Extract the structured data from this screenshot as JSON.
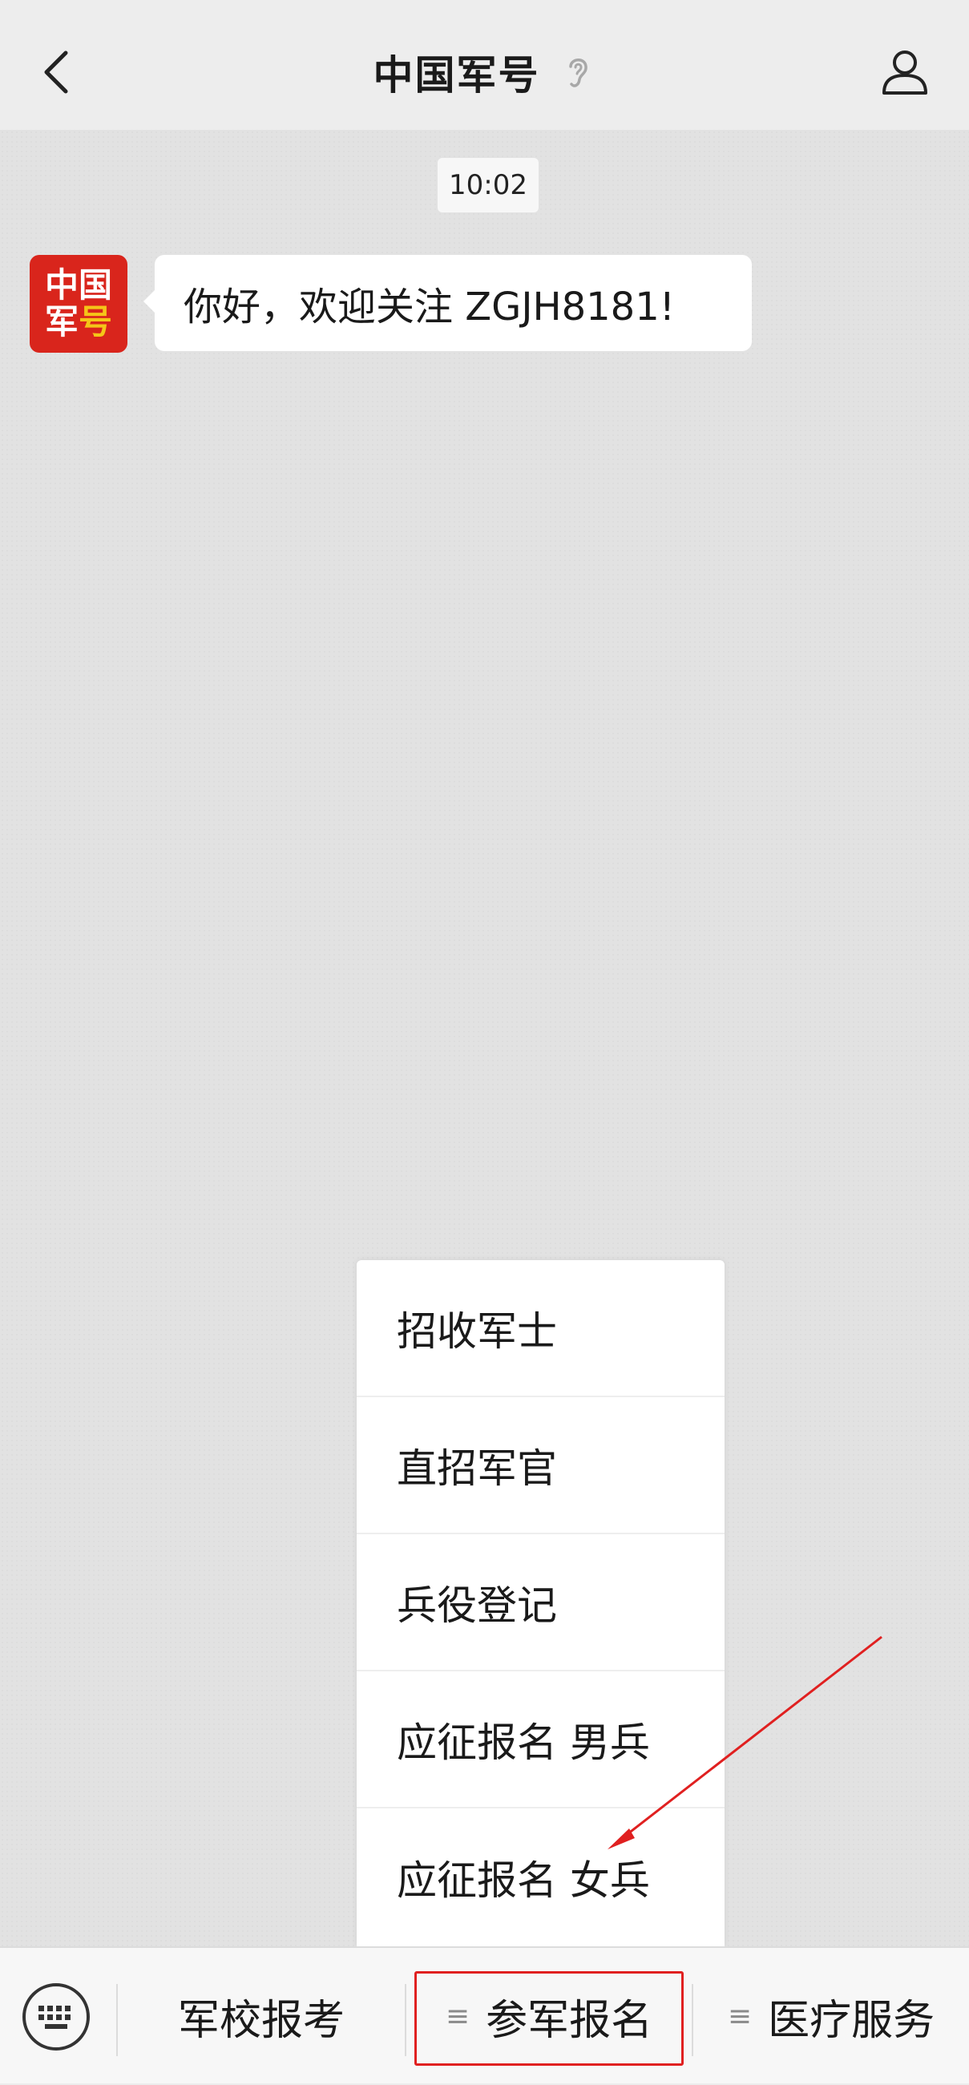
{
  "header": {
    "title": "中国军号",
    "back_icon": "chevron-left-icon",
    "ear_icon": "ear-icon",
    "profile_icon": "person-icon"
  },
  "chat": {
    "timestamp": "10:02",
    "avatar": {
      "line1": "中国",
      "line2_white": "军",
      "line2_yellow": "号"
    },
    "message": "你好，欢迎关注 ZGJH8181!"
  },
  "submenu": {
    "items": [
      "招收军士",
      "直招军官",
      "兵役登记",
      "应征报名 男兵",
      "应征报名 女兵"
    ]
  },
  "bottom_bar": {
    "keyboard_icon": "keyboard-icon",
    "menu_glyph": "≡",
    "menus": [
      "军校报考",
      "参军报名",
      "医疗服务"
    ]
  },
  "colors": {
    "accent_red": "#e02020",
    "avatar_red": "#d9251c",
    "avatar_yellow": "#f5c518"
  }
}
